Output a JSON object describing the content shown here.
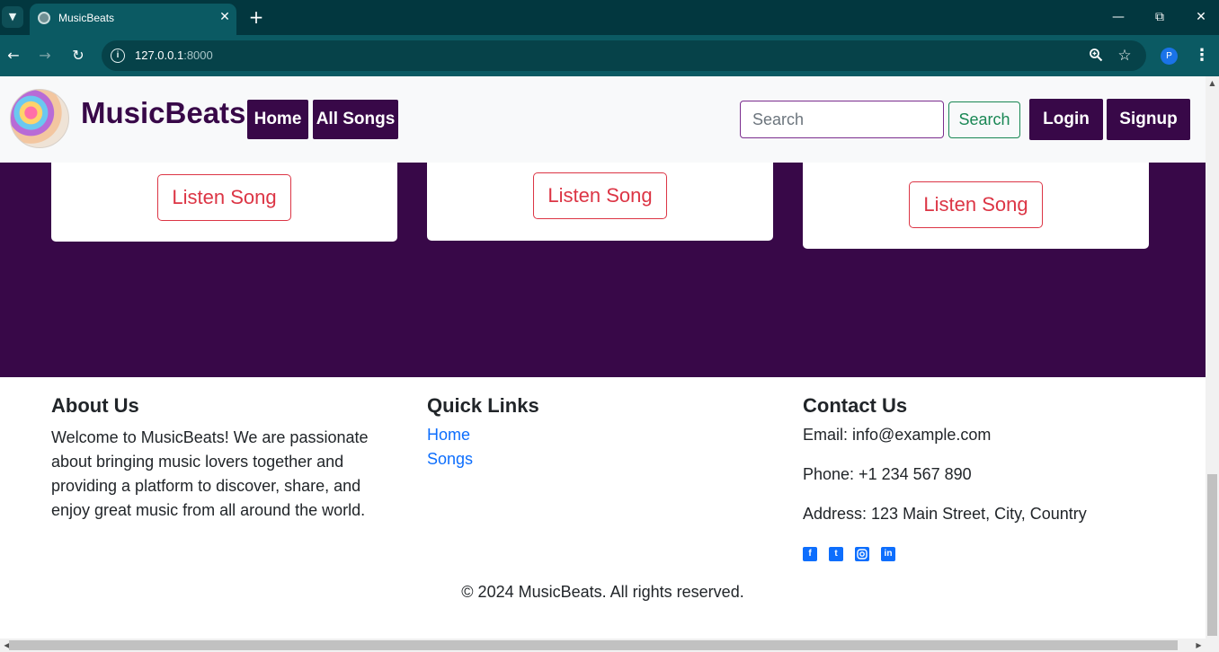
{
  "browser": {
    "tab_title": "MusicBeats",
    "url_host": "127.0.0.1",
    "url_port": ":8000",
    "profile_initial": "P"
  },
  "navbar": {
    "brand": "MusicBeats",
    "home_label": "Home",
    "all_songs_label": "All Songs",
    "search_placeholder": "Search",
    "search_button": "Search",
    "login_label": "Login",
    "signup_label": "Signup"
  },
  "songs": {
    "cards": [
      {
        "button": "Listen Song"
      },
      {
        "button": "Listen Song"
      },
      {
        "button": "Listen Song"
      }
    ]
  },
  "footer": {
    "about": {
      "heading": "About Us",
      "text": "Welcome to MusicBeats! We are passionate about bringing music lovers together and providing a platform to discover, share, and enjoy great music from all around the world."
    },
    "quick_links": {
      "heading": "Quick Links",
      "links": [
        "Home",
        "Songs"
      ]
    },
    "contact": {
      "heading": "Contact Us",
      "email": "Email: info@example.com",
      "phone": "Phone: +1 234 567 890",
      "address": "Address: 123 Main Street, City, Country",
      "social_icons": [
        "facebook-icon",
        "twitter-icon",
        "instagram-icon",
        "linkedin-icon"
      ]
    },
    "copyright": "© 2024 MusicBeats. All rights reserved."
  },
  "colors": {
    "brand_purple": "#380848",
    "chrome_teal": "#0b5a63",
    "danger": "#dc3545",
    "success": "#198754",
    "link_blue": "#0d6efd"
  }
}
